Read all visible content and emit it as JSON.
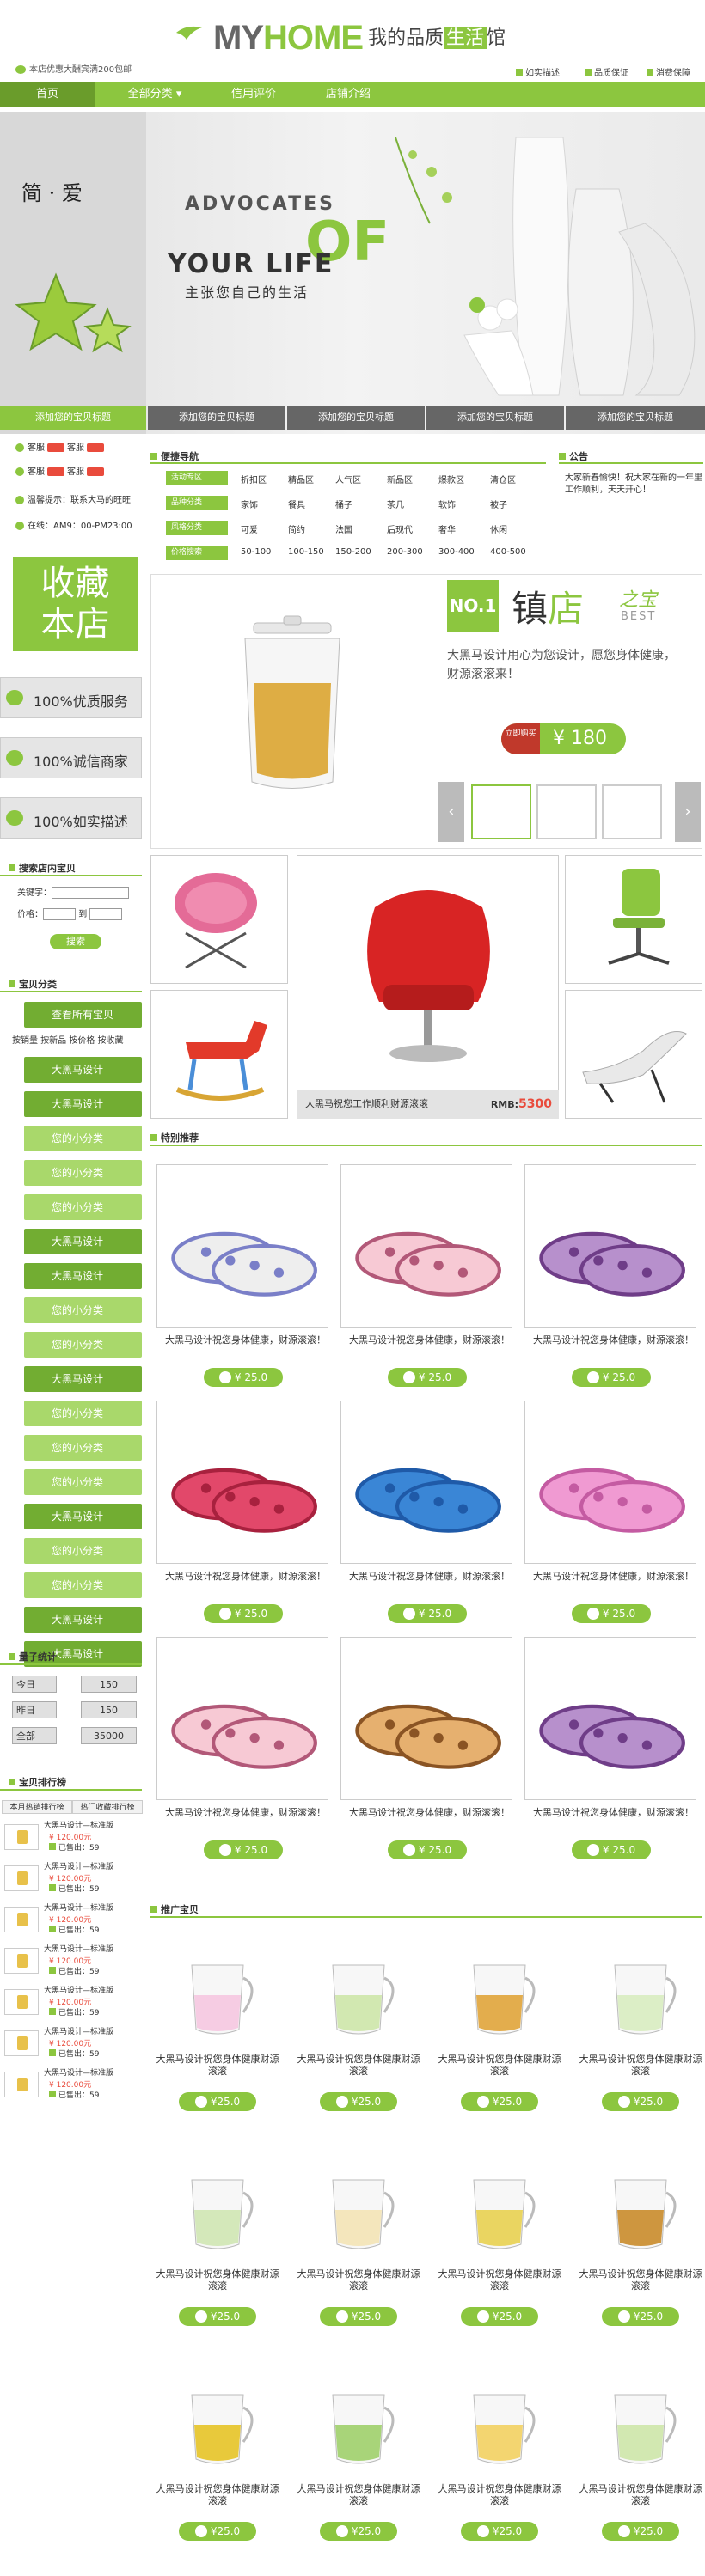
{
  "header": {
    "logo_my": "MY",
    "logo_home": "HOME",
    "slogan_a": "我的品质",
    "slogan_b": "生活",
    "slogan_c": "馆",
    "promo": "本店优惠大酬宾满200包邮",
    "badges": [
      "如实描述",
      "品质保证",
      "消费保障"
    ]
  },
  "nav": [
    "首页",
    "全部分类",
    "信用评价",
    "店铺介绍"
  ],
  "banner": {
    "left_title": "简 · 爱",
    "en1": "ADVOCATES",
    "en_of": "OF",
    "en2": "YOUR LIFE",
    "cn": "主张您自己的生活",
    "tabs": [
      "添加您的宝贝标题",
      "添加您的宝贝标题",
      "添加您的宝贝标题",
      "添加您的宝贝标题",
      "添加您的宝贝标题"
    ]
  },
  "service": {
    "kefu": "客服",
    "wangwang": "和我联系",
    "tip_label": "温馨提示：",
    "tip": "联系大马的旺旺",
    "time_label": "在线：",
    "time": "AM9：00-PM23:00"
  },
  "favorite": {
    "line1": "收藏",
    "line2": "本店"
  },
  "pills": [
    "100%优质服务",
    "100%诚信商家",
    "100%如实描述"
  ],
  "search": {
    "title": "搜索店内宝贝",
    "kw_label": "关键字：",
    "price_label": "价格：",
    "to": "到",
    "button": "搜索"
  },
  "categories": {
    "title": "宝贝分类",
    "all": "查看所有宝贝",
    "links": "按销量 按新品 按价格 按收藏",
    "items": [
      {
        "label": "大黑马设计",
        "style": "dark"
      },
      {
        "label": "大黑马设计",
        "style": "dark"
      },
      {
        "label": "您的小分类",
        "style": "light"
      },
      {
        "label": "您的小分类",
        "style": "light"
      },
      {
        "label": "您的小分类",
        "style": "light"
      },
      {
        "label": "大黑马设计",
        "style": "dark"
      },
      {
        "label": "大黑马设计",
        "style": "dark"
      },
      {
        "label": "您的小分类",
        "style": "light"
      },
      {
        "label": "您的小分类",
        "style": "light"
      },
      {
        "label": "大黑马设计",
        "style": "dark"
      },
      {
        "label": "您的小分类",
        "style": "light"
      },
      {
        "label": "您的小分类",
        "style": "light"
      },
      {
        "label": "您的小分类",
        "style": "light"
      },
      {
        "label": "大黑马设计",
        "style": "dark"
      },
      {
        "label": "您的小分类",
        "style": "light"
      },
      {
        "label": "您的小分类",
        "style": "light"
      },
      {
        "label": "大黑马设计",
        "style": "dark"
      },
      {
        "label": "大黑马设计",
        "style": "dark"
      }
    ]
  },
  "stats": {
    "title": "量子统计",
    "rows": [
      {
        "label": "今日",
        "value": "150"
      },
      {
        "label": "昨日",
        "value": "150"
      },
      {
        "label": "全部",
        "value": "35000"
      }
    ]
  },
  "ranking": {
    "title": "宝贝排行榜",
    "tabs": [
      "本月热销排行榜",
      "热门收藏排行榜"
    ],
    "items": [
      {
        "name": "大黑马设计—标准版",
        "price": "¥ 120.00元",
        "sold": "已售出：59"
      },
      {
        "name": "大黑马设计—标准版",
        "price": "¥ 120.00元",
        "sold": "已售出：59"
      },
      {
        "name": "大黑马设计—标准版",
        "price": "¥ 120.00元",
        "sold": "已售出：59"
      },
      {
        "name": "大黑马设计—标准版",
        "price": "¥ 120.00元",
        "sold": "已售出：59"
      },
      {
        "name": "大黑马设计—标准版",
        "price": "¥ 120.00元",
        "sold": "已售出：59"
      },
      {
        "name": "大黑马设计—标准版",
        "price": "¥ 120.00元",
        "sold": "已售出：59"
      },
      {
        "name": "大黑马设计—标准版",
        "price": "¥ 120.00元",
        "sold": "已售出：59"
      }
    ]
  },
  "quicknav": {
    "title": "便捷导航",
    "rows": [
      {
        "label": "活动专区",
        "cells": [
          "折扣区",
          "精品区",
          "人气区",
          "新品区",
          "爆款区",
          "清仓区"
        ]
      },
      {
        "label": "品种分类",
        "cells": [
          "家饰",
          "餐具",
          "桶子",
          "茶几",
          "软饰",
          "被子"
        ]
      },
      {
        "label": "风格分类",
        "cells": [
          "可爱",
          "简约",
          "法国",
          "后现代",
          "奢华",
          "休闲"
        ]
      },
      {
        "label": "价格搜索",
        "cells": [
          "50-100",
          "100-150",
          "150-200",
          "200-300",
          "300-400",
          "400-500"
        ]
      }
    ]
  },
  "notice": {
    "title": "公告",
    "text": "大家新春愉快！祝大家在新的一年里工作顺利，天天开心！"
  },
  "featured": {
    "no1": "NO.1",
    "title_a": "镇",
    "title_b": "店",
    "title_c": "之宝",
    "best": "BEST",
    "desc": "大黑马设计用心为您设计，愿您身体健康，财源滚滚来！",
    "buy": "立即购买",
    "price": "¥ 180"
  },
  "chairs": {
    "caption": "大黑马祝您工作顺利财源滚滚",
    "rmb_label": "RMB:",
    "rmb": "5300"
  },
  "special": {
    "title": "特别推荐",
    "items": [
      {
        "name": "大黑马设计祝您身体健康，财源滚滚！",
        "price": "¥ 25.0"
      },
      {
        "name": "大黑马设计祝您身体健康，财源滚滚！",
        "price": "¥ 25.0"
      },
      {
        "name": "大黑马设计祝您身体健康，财源滚滚！",
        "price": "¥ 25.0"
      },
      {
        "name": "大黑马设计祝您身体健康，财源滚滚！",
        "price": "¥ 25.0"
      },
      {
        "name": "大黑马设计祝您身体健康，财源滚滚！",
        "price": "¥ 25.0"
      },
      {
        "name": "大黑马设计祝您身体健康，财源滚滚！",
        "price": "¥ 25.0"
      },
      {
        "name": "大黑马设计祝您身体健康，财源滚滚！",
        "price": "¥ 25.0"
      },
      {
        "name": "大黑马设计祝您身体健康，财源滚滚！",
        "price": "¥ 25.0"
      },
      {
        "name": "大黑马设计祝您身体健康，财源滚滚！",
        "price": "¥ 25.0"
      }
    ]
  },
  "promoted": {
    "title": "推广宝贝",
    "items": [
      {
        "name": "大黑马设计祝您身体健康财源滚滚",
        "price": "¥25.0"
      },
      {
        "name": "大黑马设计祝您身体健康财源滚滚",
        "price": "¥25.0"
      },
      {
        "name": "大黑马设计祝您身体健康财源滚滚",
        "price": "¥25.0"
      },
      {
        "name": "大黑马设计祝您身体健康财源滚滚",
        "price": "¥25.0"
      },
      {
        "name": "大黑马设计祝您身体健康财源滚滚",
        "price": "¥25.0"
      },
      {
        "name": "大黑马设计祝您身体健康财源滚滚",
        "price": "¥25.0"
      },
      {
        "name": "大黑马设计祝您身体健康财源滚滚",
        "price": "¥25.0"
      },
      {
        "name": "大黑马设计祝您身体健康财源滚滚",
        "price": "¥25.0"
      },
      {
        "name": "大黑马设计祝您身体健康财源滚滚",
        "price": "¥25.0"
      },
      {
        "name": "大黑马设计祝您身体健康财源滚滚",
        "price": "¥25.0"
      },
      {
        "name": "大黑马设计祝您身体健康财源滚滚",
        "price": "¥25.0"
      },
      {
        "name": "大黑马设计祝您身体健康财源滚滚",
        "price": "¥25.0"
      }
    ]
  },
  "colors": {
    "accent": "#8cc63f",
    "accent_dark": "#72ad32",
    "price_red": "#e94b3c"
  }
}
